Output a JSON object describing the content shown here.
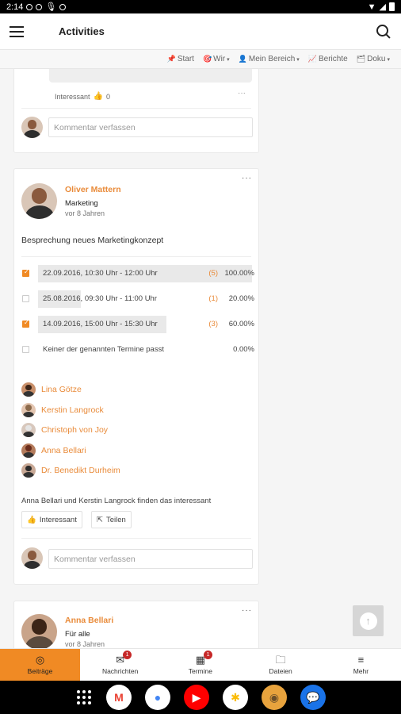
{
  "status_bar": {
    "time": "2:14"
  },
  "app_bar": {
    "title": "Activities"
  },
  "subnav": [
    {
      "icon": "📌",
      "label": "Start",
      "caret": false
    },
    {
      "icon": "🎯",
      "label": "Wir",
      "caret": true
    },
    {
      "icon": "👤",
      "label": "Mein Bereich",
      "caret": true
    },
    {
      "icon": "📈",
      "label": "Berichte",
      "caret": false
    },
    {
      "icon": "🗂",
      "label": "Doku",
      "caret": true
    }
  ],
  "prev_post": {
    "interest_label": "Interessant",
    "like_count": "0",
    "more": "···",
    "comment_placeholder": "Kommentar verfassen"
  },
  "post": {
    "author": "Oliver Mattern",
    "group": "Marketing",
    "time": "vor 8 Jahren",
    "text": "Besprechung neues Marketingkonzept",
    "more": "···",
    "poll": [
      {
        "label": "22.09.2016, 10:30 Uhr - 12:00 Uhr",
        "count": "(5)",
        "percent": "100.00%",
        "checked": true,
        "fill": 1.0
      },
      {
        "label": "25.08.2016, 09:30 Uhr - 11:00 Uhr",
        "count": "(1)",
        "percent": "20.00%",
        "checked": false,
        "fill": 0.2
      },
      {
        "label": "14.09.2016, 15:00 Uhr - 15:30 Uhr",
        "count": "(3)",
        "percent": "60.00%",
        "checked": true,
        "fill": 0.6
      },
      {
        "label": "Keiner der genannten Termine passt",
        "count": "",
        "percent": "0.00%",
        "checked": false,
        "fill": 0.0
      }
    ],
    "voters": [
      "Lina Götze",
      "Kerstin Langrock",
      "Christoph von Joy",
      "Anna Bellari",
      "Dr. Benedikt Durheim"
    ],
    "likes_text": "Anna Bellari und Kerstin Langrock finden das interessant",
    "like_button": "Interessant",
    "share_button": "Teilen",
    "comment_placeholder": "Kommentar verfassen"
  },
  "next_post": {
    "author": "Anna Bellari",
    "group": "Für alle",
    "time": "vor 8 Jahren",
    "more": "···"
  },
  "bottom_nav": [
    {
      "label": "Beiträge",
      "icon": "◎",
      "badge": ""
    },
    {
      "label": "Nachrichten",
      "icon": "✉",
      "badge": "1"
    },
    {
      "label": "Termine",
      "icon": "▦",
      "badge": "1"
    },
    {
      "label": "Dateien",
      "icon": "🗀",
      "badge": ""
    },
    {
      "label": "Mehr",
      "icon": "≡",
      "badge": ""
    }
  ],
  "dock": [
    {
      "name": "Gmail",
      "glyph": "M",
      "color": "#ea4335",
      "bg": "#ffffff"
    },
    {
      "name": "Chrome",
      "glyph": "●",
      "color": "#4285f4",
      "bg": "#ffffff"
    },
    {
      "name": "YouTube",
      "glyph": "▶",
      "color": "#ffffff",
      "bg": "#ff0000"
    },
    {
      "name": "Photos",
      "glyph": "✱",
      "color": "#fbbc05",
      "bg": "#ffffff"
    },
    {
      "name": "App",
      "glyph": "◉",
      "color": "#6b4f2a",
      "bg": "#e8a33d"
    },
    {
      "name": "Messages",
      "glyph": "💬",
      "color": "#ffffff",
      "bg": "#1a73e8"
    }
  ],
  "colors": {
    "accent": "#f08a24",
    "link": "#e98b3a",
    "badge": "#c62828"
  }
}
